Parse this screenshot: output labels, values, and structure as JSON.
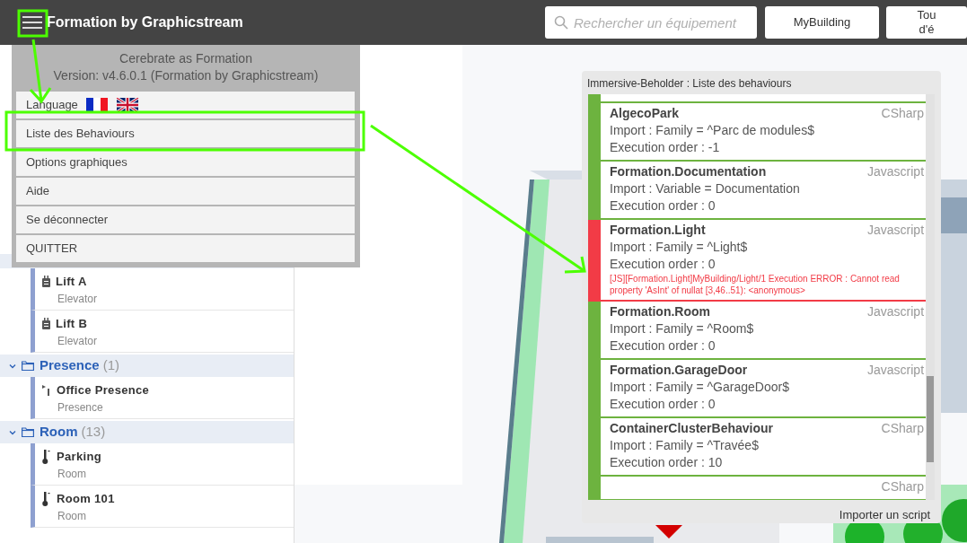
{
  "header": {
    "title": "Formation by Graphicstream",
    "search": {
      "placeholder": "Rechercher un équipement"
    },
    "buttons": [
      {
        "lines": [
          "MyBuilding"
        ]
      },
      {
        "lines": [
          "Tou",
          "d'é"
        ]
      }
    ]
  },
  "menu": {
    "app_name": "Cerebrate as Formation",
    "version": "Version: v4.6.0.1 (Formation by Graphicstream)",
    "items": [
      {
        "kind": "language",
        "label": "Language"
      },
      {
        "kind": "item",
        "label": "Liste des Behaviours"
      },
      {
        "kind": "item",
        "label": "Options graphiques"
      },
      {
        "kind": "item",
        "label": "Aide"
      },
      {
        "kind": "item",
        "label": "Se déconnecter"
      },
      {
        "kind": "item",
        "label": "QUITTER"
      }
    ]
  },
  "sidebar": {
    "items": [
      {
        "kind": "elevator",
        "name": "Lift A",
        "type": "Elevator"
      },
      {
        "kind": "elevator",
        "name": "Lift B",
        "type": "Elevator"
      },
      {
        "kind": "group",
        "name": "Presence",
        "count": "(1)",
        "expanded": true
      },
      {
        "kind": "presence",
        "name": "Office Presence",
        "type": "Presence"
      },
      {
        "kind": "group",
        "name": "Room",
        "count": "(13)",
        "expanded": true
      },
      {
        "kind": "room",
        "name": "Parking",
        "type": "Room"
      },
      {
        "kind": "room",
        "name": "Room 101",
        "type": "Room"
      }
    ]
  },
  "behaviours_panel": {
    "title": "Immersive-Beholder : Liste des behaviours",
    "items": [
      {
        "name": "AlgecoPark",
        "language": "CSharp",
        "import": "Import : Family = ^Parc de modules$",
        "order": "Execution order : -1",
        "color": "#6db33f"
      },
      {
        "name": "Formation.Documentation",
        "language": "Javascript",
        "import": "Import : Variable = Documentation",
        "order": "Execution order : 0",
        "color": "#6db33f"
      },
      {
        "name": "Formation.Light",
        "language": "Javascript",
        "import": "Import : Family = ^Light$",
        "order": "Execution order : 0",
        "error": "[JS][Formation.Light]MyBuilding/Light/1 Execution ERROR : Cannot read property 'AsInt' of nullat [3,46..51): <anonymous>",
        "color": "#f23b46"
      },
      {
        "name": "Formation.Room",
        "language": "Javascript",
        "import": "Import : Family = ^Room$",
        "order": "Execution order : 0",
        "color": "#6db33f"
      },
      {
        "name": "Formation.GarageDoor",
        "language": "Javascript",
        "import": "Import : Family = ^GarageDoor$",
        "order": "Execution order : 0",
        "color": "#6db33f"
      },
      {
        "name": "ContainerClusterBehaviour",
        "language": "CSharp",
        "import": "Import : Family = ^Travée$",
        "order": "Execution order : 10",
        "color": "#6db33f"
      },
      {
        "language": "CSharp",
        "color": "#6db33f"
      }
    ],
    "footer": "Importer un script"
  }
}
